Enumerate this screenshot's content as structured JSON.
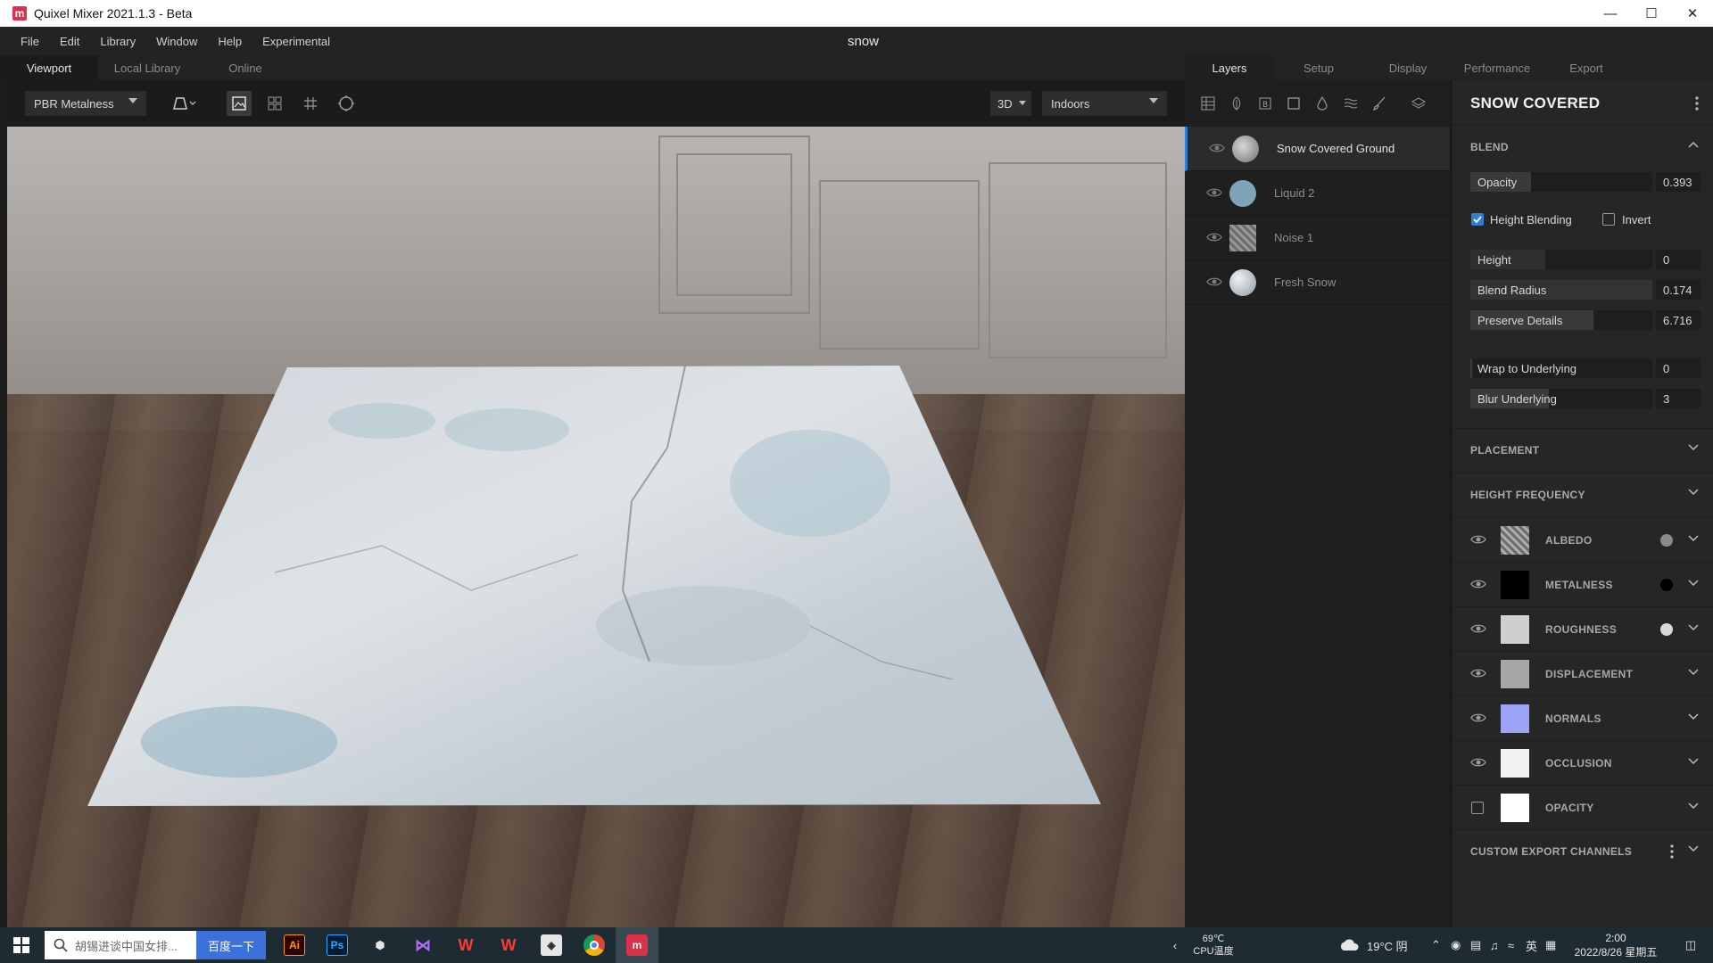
{
  "window": {
    "title": "Quixel Mixer 2021.1.3 - Beta",
    "app_icon": "m"
  },
  "menu": {
    "items": [
      "File",
      "Edit",
      "Library",
      "Window",
      "Help",
      "Experimental"
    ],
    "project_name": "snow"
  },
  "left_tabs": [
    "Viewport",
    "Local Library",
    "Online"
  ],
  "right_tabs": [
    "Layers",
    "Setup",
    "Display",
    "Performance",
    "Export"
  ],
  "toolbar": {
    "shading_mode": "PBR Metalness",
    "view_mode": "3D",
    "environment": "Indoors"
  },
  "layers": [
    {
      "name": "Snow Covered Ground",
      "selected": true,
      "thumb_color": "#9a9a9a"
    },
    {
      "name": "Liquid 2",
      "selected": false,
      "thumb_color": "#7fa4b8"
    },
    {
      "name": "Noise 1",
      "selected": false,
      "thumb_color": "#8a8a8a"
    },
    {
      "name": "Fresh Snow",
      "selected": false,
      "thumb_color": "#c7cfd6"
    }
  ],
  "properties": {
    "title": "SNOW COVERED",
    "blend_header": "BLEND",
    "opacity": {
      "label": "Opacity",
      "value": "0.393",
      "fraction": 0.33
    },
    "height_blending_label": "Height Blending",
    "invert_label": "Invert",
    "height": {
      "label": "Height",
      "value": "0",
      "fraction": 0.41
    },
    "blend_radius": {
      "label": "Blend Radius",
      "value": "0.174",
      "fraction": 0.18
    },
    "preserve_details": {
      "label": "Preserve Details",
      "value": "6.716",
      "fraction": 0.56
    },
    "wrap_to_underlying": {
      "label": "Wrap to Underlying",
      "value": "0",
      "fraction": 0.0
    },
    "blur_underlying": {
      "label": "Blur Underlying",
      "value": "3",
      "fraction": 0.35
    },
    "placement_header": "PLACEMENT",
    "height_frequency_header": "HEIGHT FREQUENCY",
    "channels": [
      {
        "name": "ALBEDO",
        "thumb": "#8e8e8e",
        "dot": "#8a8a8a",
        "visible": true
      },
      {
        "name": "METALNESS",
        "thumb": "#000000",
        "dot": "#000000",
        "visible": true
      },
      {
        "name": "ROUGHNESS",
        "thumb": "#cfcfcf",
        "dot": "#d9d9d9",
        "visible": true
      },
      {
        "name": "DISPLACEMENT",
        "thumb": "#a6a6a6",
        "dot": "",
        "visible": true
      },
      {
        "name": "NORMALS",
        "thumb": "#9da3f5",
        "dot": "",
        "visible": true
      },
      {
        "name": "OCCLUSION",
        "thumb": "#f2f2f2",
        "dot": "",
        "visible": true
      },
      {
        "name": "OPACITY",
        "thumb": "#ffffff",
        "dot": "",
        "visible": false
      }
    ],
    "custom_export_header": "CUSTOM EXPORT CHANNELS"
  },
  "taskbar": {
    "search_placeholder": "胡锡进谈中国女排...",
    "search_button": "百度一下",
    "cpu_temp": "69℃",
    "cpu_label": "CPU温度",
    "weather": "19°C 阴",
    "ime": "英",
    "time": "2:00",
    "date": "2022/8/26 星期五"
  },
  "colors": {
    "accent": "#2d7fd1",
    "panel": "#262626",
    "taskbar": "#1f2b33"
  }
}
